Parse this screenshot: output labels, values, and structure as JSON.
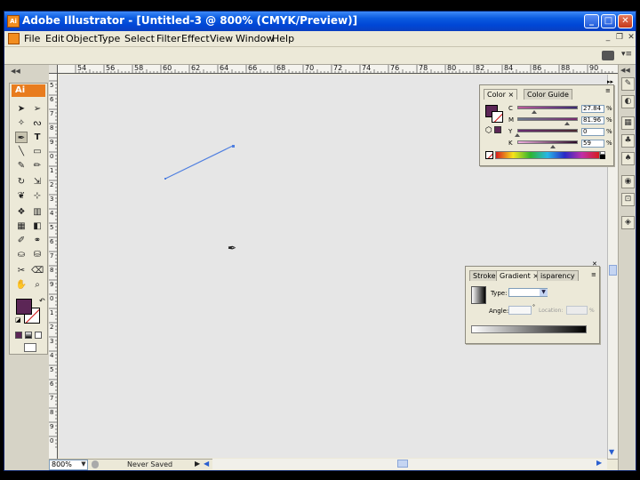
{
  "window": {
    "title": "Adobe Illustrator - [Untitled-3 @ 800% (CMYK/Preview)]",
    "controls": {
      "minimize": "_",
      "maximize": "□",
      "close": "✕"
    }
  },
  "menu": [
    "File",
    "Edit",
    "Object",
    "Type",
    "Select",
    "Filter",
    "Effect",
    "View",
    "Window",
    "Help"
  ],
  "mdi_controls": {
    "minimize": "_",
    "restore": "❐",
    "close": "✕"
  },
  "toolbox": {
    "logo": "Ai",
    "fill_color": "#5c2656",
    "stroke": "none"
  },
  "rulers": {
    "top": [
      "54",
      "56",
      "58",
      "60",
      "62",
      "64",
      "66",
      "68",
      "70",
      "72",
      "74",
      "76",
      "78",
      "80",
      "82",
      "84",
      "86",
      "88",
      "90"
    ],
    "left": [
      "5",
      "6",
      "7",
      "8",
      "9",
      "0",
      "1",
      "2",
      "3",
      "4",
      "5",
      "6",
      "7",
      "8",
      "9",
      "0",
      "1",
      "2",
      "3",
      "4",
      "5",
      "6",
      "7",
      "8",
      "9",
      "0"
    ]
  },
  "status": {
    "zoom": "800%",
    "zoom_arrow": "▼",
    "text": "Never Saved",
    "arrow": "▶",
    "scroll_left": "◀"
  },
  "color_panel": {
    "tabs": [
      "Color",
      "Color Guide"
    ],
    "tab_close": "×",
    "fill_color": "#5c2656",
    "channels": [
      {
        "label": "C",
        "value": "27.84",
        "fraction": 0.28,
        "gradient": "linear-gradient(to right,#c05c9c,#3a2a70)"
      },
      {
        "label": "M",
        "value": "81.96",
        "fraction": 0.82,
        "gradient": "linear-gradient(to right,#6a7a8e,#7a2a6e)"
      },
      {
        "label": "Y",
        "value": "0",
        "fraction": 0.0,
        "gradient": "linear-gradient(to right,#6a2a72,#4a2a30)"
      },
      {
        "label": "K",
        "value": "59",
        "fraction": 0.59,
        "gradient": "linear-gradient(to right,#f0b0e0,#2a0a28)"
      }
    ],
    "unit": "%"
  },
  "gradient_panel": {
    "tabs": [
      "Stroke",
      "Gradient",
      "isparency"
    ],
    "tab_close": "×",
    "type_label": "Type:",
    "angle_label": "Angle:",
    "location_label": "Location:",
    "unit": "%"
  }
}
